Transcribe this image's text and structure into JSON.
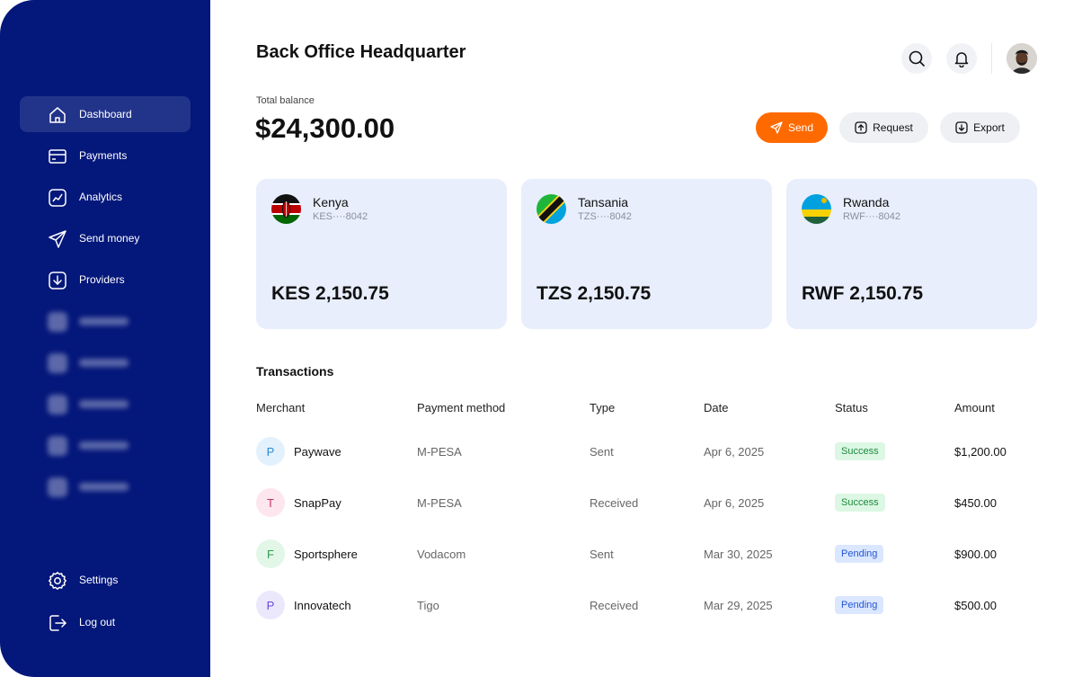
{
  "sidebar": {
    "items": [
      {
        "label": "Dashboard",
        "icon": "home-icon"
      },
      {
        "label": "Payments",
        "icon": "card-icon"
      },
      {
        "label": "Analytics",
        "icon": "chart-icon"
      },
      {
        "label": "Send money",
        "icon": "send-icon"
      },
      {
        "label": "Providers",
        "icon": "download-icon"
      }
    ],
    "footer": [
      {
        "label": "Settings",
        "icon": "gear-icon"
      },
      {
        "label": "Log out",
        "icon": "logout-icon"
      }
    ]
  },
  "header": {
    "title": "Back Office Headquarter"
  },
  "balance": {
    "label": "Total balance",
    "amount": "$24,300.00"
  },
  "actions": {
    "send": "Send",
    "request": "Request",
    "export": "Export"
  },
  "cards": [
    {
      "country": "Kenya",
      "account": "KES····8042",
      "balance": "KES 2,150.75"
    },
    {
      "country": "Tansania",
      "account": "TZS····8042",
      "balance": "TZS 2,150.75"
    },
    {
      "country": "Rwanda",
      "account": "RWF····8042",
      "balance": "RWF 2,150.75"
    }
  ],
  "transactions": {
    "title": "Transactions",
    "headers": [
      "Merchant",
      "Payment method",
      "Type",
      "Date",
      "Status",
      "Amount"
    ],
    "rows": [
      {
        "initial": "P",
        "merchant": "Paywave",
        "method": "M-PESA",
        "type": "Sent",
        "date": "Apr 6, 2025",
        "status": "Success",
        "amount": "$1,200.00"
      },
      {
        "initial": "T",
        "merchant": "SnapPay",
        "method": "M-PESA",
        "type": "Received",
        "date": "Apr 6, 2025",
        "status": "Success",
        "amount": "$450.00"
      },
      {
        "initial": "F",
        "merchant": "Sportsphere",
        "method": "Vodacom",
        "type": "Sent",
        "date": "Mar 30, 2025",
        "status": "Pending",
        "amount": "$900.00"
      },
      {
        "initial": "P",
        "merchant": "Innovatech",
        "method": "Tigo",
        "type": "Received",
        "date": "Mar 29, 2025",
        "status": "Pending",
        "amount": "$500.00"
      }
    ]
  },
  "colors": {
    "sidebar": "#04177a",
    "accent": "#ff6a00",
    "card": "#e8eefc"
  }
}
